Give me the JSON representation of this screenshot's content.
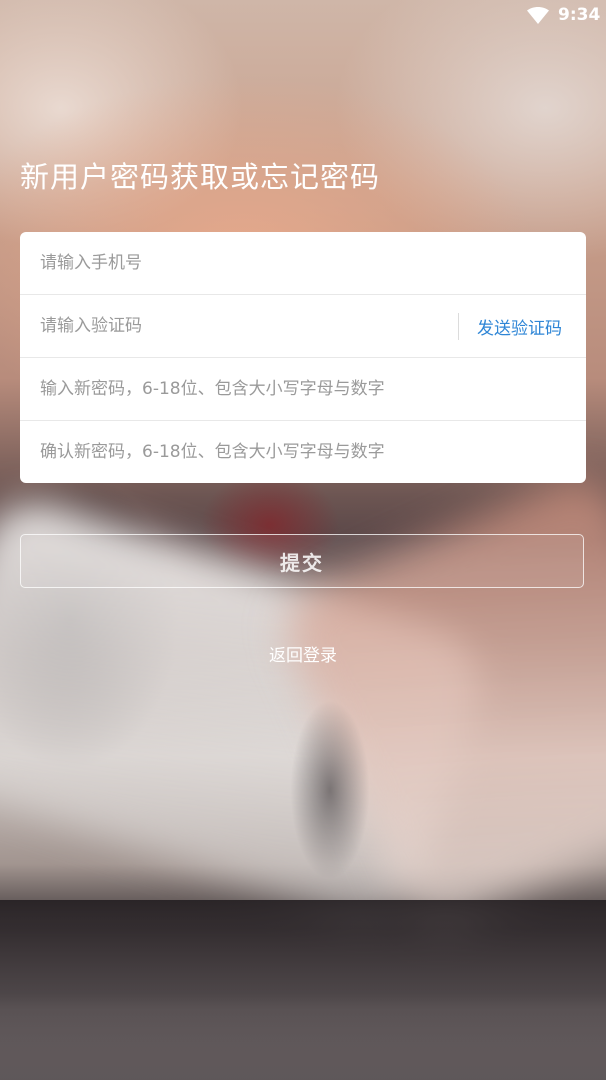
{
  "status_bar": {
    "time": "9:34",
    "wifi_icon": "wifi-icon"
  },
  "title": "新用户密码获取或忘记密码",
  "form": {
    "phone_placeholder": "请输入手机号",
    "code_placeholder": "请输入验证码",
    "send_code_label": "发送验证码",
    "new_password_placeholder": "输入新密码，6-18位、包含大小写字母与数字",
    "confirm_password_placeholder": "确认新密码，6-18位、包含大小写字母与数字"
  },
  "submit_label": "提交",
  "back_to_login_label": "返回登录",
  "colors": {
    "accent_link": "#2f86d6",
    "card_bg": "#ffffff",
    "text_on_bg": "#ffffff"
  }
}
